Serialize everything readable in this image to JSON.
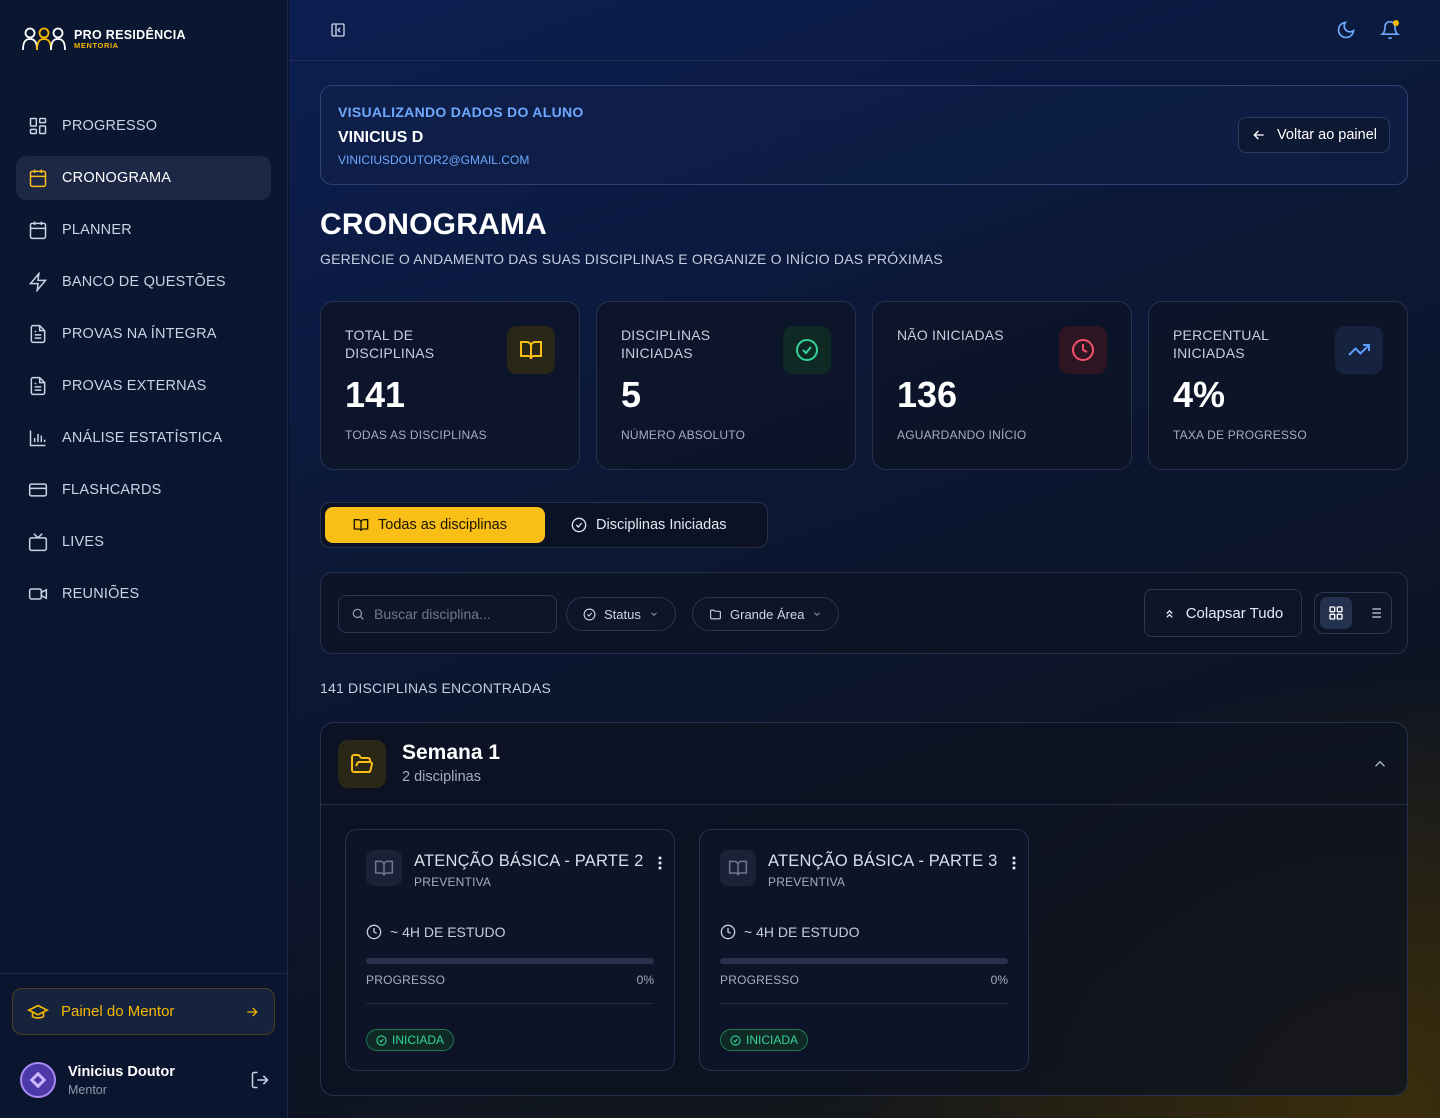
{
  "brand": {
    "title": "PRO RESIDÊNCIA",
    "subtitle": "MENTORIA"
  },
  "sidebar": {
    "items": [
      {
        "label": "PROGRESSO",
        "icon": "layout-grid-icon"
      },
      {
        "label": "CRONOGRAMA",
        "icon": "calendar-icon",
        "active": true
      },
      {
        "label": "PLANNER",
        "icon": "calendar-days-icon"
      },
      {
        "label": "BANCO DE QUESTÕES",
        "icon": "zap-icon"
      },
      {
        "label": "PROVAS NA ÍNTEGRA",
        "icon": "file-text-icon"
      },
      {
        "label": "PROVAS EXTERNAS",
        "icon": "file-text-icon"
      },
      {
        "label": "ANÁLISE ESTATÍSTICA",
        "icon": "bar-chart-icon"
      },
      {
        "label": "FLASHCARDS",
        "icon": "credit-card-icon"
      },
      {
        "label": "LIVES",
        "icon": "tv-icon"
      },
      {
        "label": "REUNIÕES",
        "icon": "video-icon"
      }
    ],
    "mentor_button": "Painel do Mentor",
    "user": {
      "name": "Vinicius Doutor",
      "role": "Mentor"
    }
  },
  "viewing": {
    "label": "VISUALIZANDO DADOS DO ALUNO",
    "student_name": "VINICIUS D",
    "student_email": "VINICIUSDOUTOR2@GMAIL.COM",
    "back_label": "Voltar ao painel"
  },
  "page": {
    "title": "CRONOGRAMA",
    "subtitle": "GERENCIE O ANDAMENTO DAS SUAS DISCIPLINAS E ORGANIZE O INÍCIO DAS PRÓXIMAS"
  },
  "stats": [
    {
      "label": "TOTAL DE DISCIPLINAS",
      "value": "141",
      "foot": "TODAS AS DISCIPLINAS",
      "icon": "book-open-icon",
      "color": "#f9bf17",
      "bg": "#2a2716"
    },
    {
      "label": "DISCIPLINAS INICIADAS",
      "value": "5",
      "foot": "NÚMERO ABSOLUTO",
      "icon": "check-circle-icon",
      "color": "#34d399",
      "bg": "#0f2a24"
    },
    {
      "label": "NÃO INICIADAS",
      "value": "136",
      "foot": "AGUARDANDO INÍCIO",
      "icon": "clock-icon",
      "color": "#f4506b",
      "bg": "#2d1622"
    },
    {
      "label": "PERCENTUAL INICIADAS",
      "value": "4%",
      "foot": "TAXA DE PROGRESSO",
      "icon": "trending-up-icon",
      "color": "#5b9cff",
      "bg": "#15233f"
    }
  ],
  "tabs": [
    {
      "label": "Todas as disciplinas",
      "active": true
    },
    {
      "label": "Disciplinas Iniciadas",
      "active": false
    }
  ],
  "filters": {
    "search_placeholder": "Buscar disciplina...",
    "status_label": "Status",
    "area_label": "Grande Área",
    "collapse_label": "Colapsar Tudo",
    "view_mode": "grid"
  },
  "results_text": "141 DISCIPLINAS ENCONTRADAS",
  "week": {
    "title": "Semana 1",
    "count": "2 disciplinas",
    "cards": [
      {
        "title": "ATENÇÃO BÁSICA - PARTE 2",
        "area": "PREVENTIVA",
        "hours": "~ 4H DE ESTUDO",
        "progress_label": "PROGRESSO",
        "progress": "0%",
        "status": "INICIADA"
      },
      {
        "title": "ATENÇÃO BÁSICA - PARTE 3",
        "area": "PREVENTIVA",
        "hours": "~ 4H DE ESTUDO",
        "progress_label": "PROGRESSO",
        "progress": "0%",
        "status": "INICIADA"
      }
    ]
  },
  "colors": {
    "accent": "#f9bf17",
    "primary_blue": "#6fa8ff",
    "success": "#34d399",
    "danger": "#f4506b"
  }
}
